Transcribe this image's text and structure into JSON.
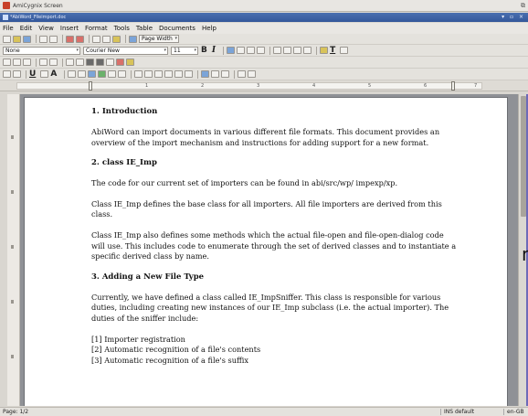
{
  "screen": {
    "title": "AmiCygnix Screen"
  },
  "window": {
    "title": "*AbiWord_Fileimport.doc",
    "controls": "▾ ▫ ×"
  },
  "menubar": {
    "items": [
      "File",
      "Edit",
      "View",
      "Insert",
      "Format",
      "Tools",
      "Table",
      "Documents",
      "Help"
    ]
  },
  "toolbar": {
    "zoom": "Page Width",
    "style": "None",
    "font": "Courier New",
    "size": "11",
    "bold": "B",
    "italic": "I",
    "underline": "U",
    "text_color_icon": "text-color-icon"
  },
  "ruler": {
    "numbers": [
      "1",
      "2",
      "3",
      "4",
      "5",
      "6",
      "7"
    ]
  },
  "document": {
    "sections": [
      {
        "heading": "1.  Introduction",
        "paragraphs": [
          "AbiWord can import documents in various different file formats.  This document provides an overview of the import mechanism and instructions for adding support for a new format."
        ]
      },
      {
        "heading": "2.  class IE_Imp",
        "paragraphs": [
          "The code for our current set of importers can be found in abi/src/wp/ impexp/xp.",
          "Class IE_Imp defines the base class for all importers.  All file importers are derived from this class.",
          "Class IE_Imp also defines some methods which the actual file-open and file-open-dialog code will use.  This includes code to enumerate through the set of derived classes and to instantiate a specific derived class by name."
        ]
      },
      {
        "heading": "3.  Adding a New File Type",
        "paragraphs": [
          "Currently, we have defined a class called IE_ImpSniffer. This class is responsible for various duties, including creating new instances of our IE_Imp subclass (i.e. the actual importer).  The duties of the sniffer include:"
        ]
      }
    ],
    "list": [
      "[1] Importer registration",
      "[2] Automatic recognition of a file's contents",
      "[3] Automatic recognition of a file's suffix"
    ]
  },
  "statusbar": {
    "page": "Page: 1/2",
    "mode": "INS default",
    "lang": "en-GB"
  },
  "edge_text": "n"
}
